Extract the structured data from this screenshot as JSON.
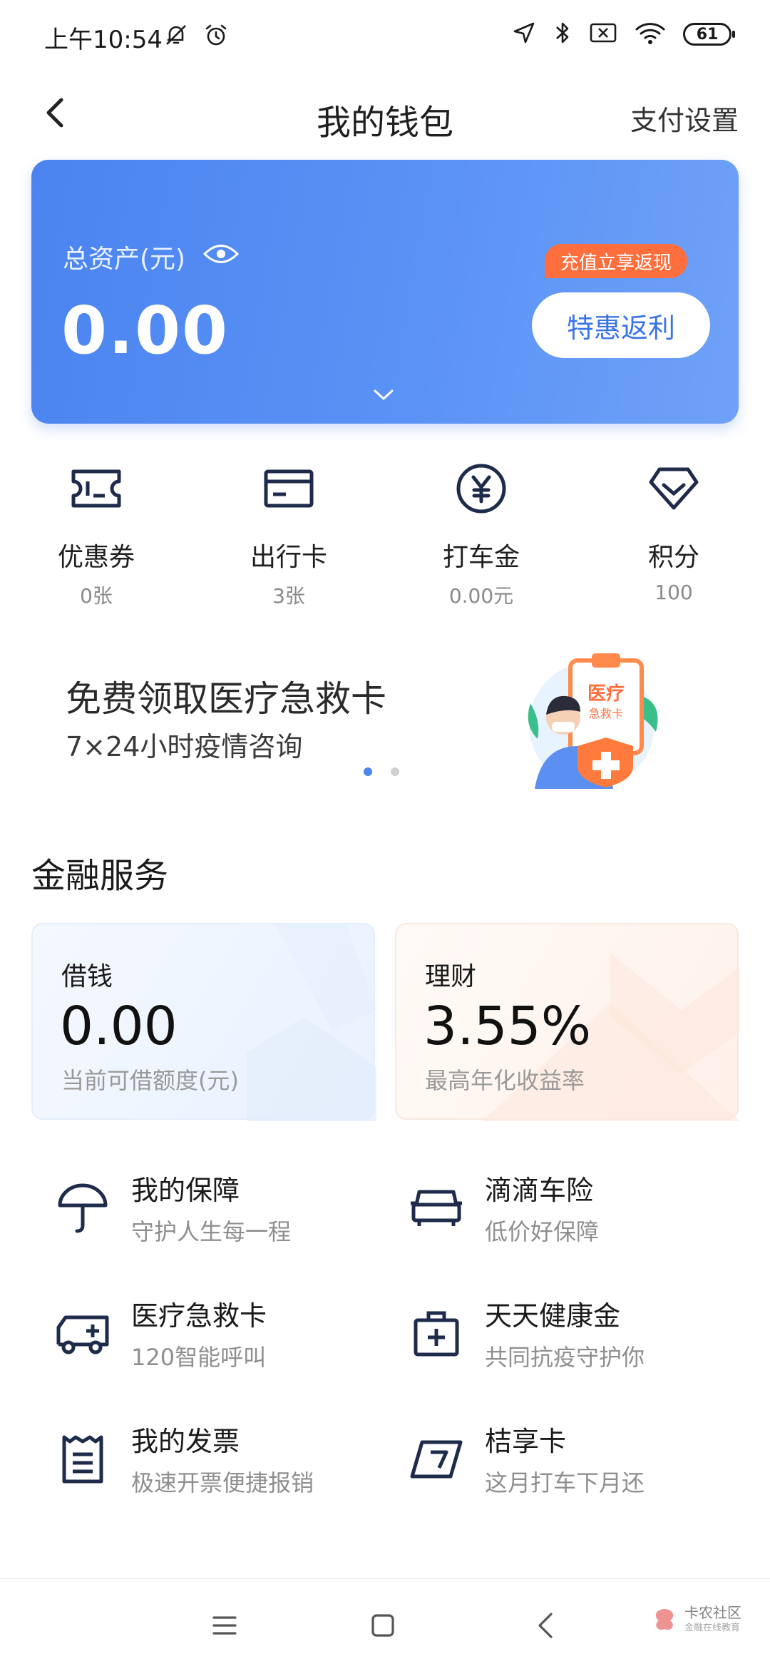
{
  "status_bar": {
    "time": "上午10:54",
    "battery": "61"
  },
  "header": {
    "title": "我的钱包",
    "right_action": "支付设置"
  },
  "asset_card": {
    "label": "总资产(元)",
    "value": "0.00",
    "promo_tag": "充值立享返现",
    "promo_button": "特惠返利",
    "accent": "#4b84f0"
  },
  "quick_entries": [
    {
      "label": "优惠券",
      "sub": "0张",
      "icon": "ticket-icon"
    },
    {
      "label": "出行卡",
      "sub": "3张",
      "icon": "card-icon"
    },
    {
      "label": "打车金",
      "sub": "0.00元",
      "icon": "yen-coin-icon"
    },
    {
      "label": "积分",
      "sub": "100",
      "icon": "diamond-icon"
    }
  ],
  "banner": {
    "title": "免费领取医疗急救卡",
    "subtitle": "7×24小时疫情咨询",
    "art_text_1": "医疗",
    "art_text_2": "急救卡"
  },
  "finance": {
    "title": "金融服务",
    "borrow": {
      "name": "借钱",
      "value": "0.00",
      "desc": "当前可借额度(元)"
    },
    "invest": {
      "name": "理财",
      "value": "3.55%",
      "desc": "最高年化收益率"
    }
  },
  "services": [
    {
      "title": "我的保障",
      "sub": "守护人生每一程",
      "icon": "umbrella-icon"
    },
    {
      "title": "滴滴车险",
      "sub": "低价好保障",
      "icon": "car-icon"
    },
    {
      "title": "医疗急救卡",
      "sub": "120智能呼叫",
      "icon": "ambulance-icon"
    },
    {
      "title": "天天健康金",
      "sub": "共同抗疫守护你",
      "icon": "medical-kit-icon"
    },
    {
      "title": "我的发票",
      "sub": "极速开票便捷报销",
      "icon": "invoice-icon"
    },
    {
      "title": "桔享卡",
      "sub": "这月打车下月还",
      "icon": "credit-card-icon"
    }
  ],
  "watermark": {
    "name": "卡农社区",
    "tagline": "金融在线教育"
  }
}
